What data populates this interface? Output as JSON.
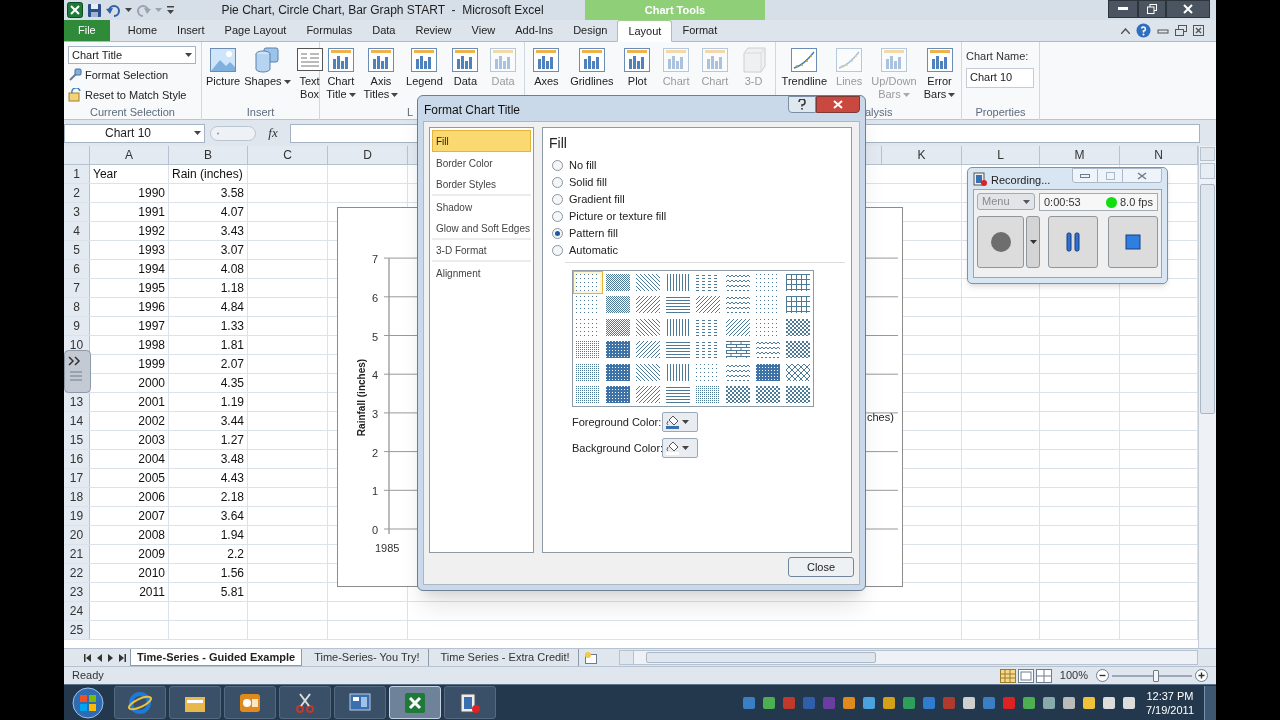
{
  "title_bar": {
    "title": "Pie Chart, Circle Chart, Bar Graph START  -  Microsoft Excel",
    "context_label": "Chart Tools"
  },
  "ribbon_tabs": [
    {
      "label": "File",
      "kind": "file",
      "selected": false
    },
    {
      "label": "Home",
      "kind": "tab",
      "selected": false
    },
    {
      "label": "Insert",
      "kind": "tab",
      "selected": false
    },
    {
      "label": "Page Layout",
      "kind": "tab",
      "selected": false
    },
    {
      "label": "Formulas",
      "kind": "tab",
      "selected": false
    },
    {
      "label": "Data",
      "kind": "tab",
      "selected": false
    },
    {
      "label": "Review",
      "kind": "tab",
      "selected": false
    },
    {
      "label": "View",
      "kind": "tab",
      "selected": false
    },
    {
      "label": "Add-Ins",
      "kind": "tab",
      "selected": false
    },
    {
      "label": "Design",
      "kind": "tab",
      "selected": false
    },
    {
      "label": "Layout",
      "kind": "tab",
      "selected": true
    },
    {
      "label": "Format",
      "kind": "tab",
      "selected": false
    }
  ],
  "ribbon_groups": [
    {
      "kind": "selection",
      "label": "Current Selection",
      "element": "Chart Title",
      "commands": [
        "Format Selection",
        "Reset to Match Style"
      ]
    },
    {
      "kind": "buttons",
      "label": "Insert",
      "buttons": [
        {
          "lines": [
            "Picture"
          ],
          "dropdown": false,
          "disabled": false
        },
        {
          "lines": [
            "Shapes"
          ],
          "dropdown": true,
          "disabled": false
        },
        {
          "lines": [
            "Text",
            "Box"
          ],
          "dropdown": false,
          "disabled": false
        }
      ]
    },
    {
      "kind": "buttons",
      "label": "L",
      "buttons": [
        {
          "lines": [
            "Chart",
            "Title"
          ],
          "dropdown": true,
          "disabled": false
        },
        {
          "lines": [
            "Axis",
            "Titles"
          ],
          "dropdown": true,
          "disabled": false
        },
        {
          "lines": [
            "Legend"
          ],
          "dropdown": false,
          "disabled": false
        },
        {
          "lines": [
            "Data"
          ],
          "dropdown": false,
          "disabled": false
        },
        {
          "lines": [
            "Data"
          ],
          "dropdown": false,
          "disabled": true
        }
      ]
    },
    {
      "kind": "buttons",
      "buttons": [
        {
          "lines": [
            "Axes"
          ],
          "dropdown": false,
          "disabled": false
        },
        {
          "lines": [
            "Gridlines"
          ],
          "dropdown": false,
          "disabled": false
        },
        {
          "lines": [
            "Plot"
          ],
          "dropdown": false,
          "disabled": false
        },
        {
          "lines": [
            "Chart"
          ],
          "dropdown": false,
          "disabled": true
        },
        {
          "lines": [
            "Chart"
          ],
          "dropdown": false,
          "disabled": true
        },
        {
          "lines": [
            "3-D"
          ],
          "dropdown": false,
          "disabled": true
        }
      ]
    },
    {
      "kind": "buttons",
      "label": "alysis",
      "buttons": [
        {
          "lines": [
            "Trendline"
          ],
          "dropdown": false,
          "disabled": false
        },
        {
          "lines": [
            "Lines"
          ],
          "dropdown": false,
          "disabled": true
        },
        {
          "lines": [
            "Up/Down",
            "Bars"
          ],
          "dropdown": true,
          "disabled": true
        },
        {
          "lines": [
            "Error",
            "Bars"
          ],
          "dropdown": true,
          "disabled": false
        }
      ]
    },
    {
      "kind": "properties",
      "label": "Properties",
      "field_label": "Chart Name:",
      "field_value": "Chart 10"
    }
  ],
  "formula_bar": {
    "name_box": "Chart 10",
    "function_label": "fx"
  },
  "sheet": {
    "columns": [
      "A",
      "B",
      "C",
      "D",
      "K",
      "L",
      "M",
      "N"
    ],
    "rows": [
      {
        "number": "1",
        "kind": "header",
        "cells": [
          "Year",
          "Rain (inches)"
        ]
      },
      {
        "number": "2",
        "kind": "data",
        "cells": [
          "1990",
          "3.58"
        ]
      },
      {
        "number": "3",
        "kind": "data",
        "cells": [
          "1991",
          "4.07"
        ]
      },
      {
        "number": "4",
        "kind": "data",
        "cells": [
          "1992",
          "3.43"
        ]
      },
      {
        "number": "5",
        "kind": "data",
        "cells": [
          "1993",
          "3.07"
        ]
      },
      {
        "number": "6",
        "kind": "data",
        "cells": [
          "1994",
          "4.08"
        ]
      },
      {
        "number": "7",
        "kind": "data",
        "cells": [
          "1995",
          "1.18"
        ]
      },
      {
        "number": "8",
        "kind": "data",
        "cells": [
          "1996",
          "4.84"
        ]
      },
      {
        "number": "9",
        "kind": "data",
        "cells": [
          "1997",
          "1.33"
        ]
      },
      {
        "number": "10",
        "kind": "data",
        "cells": [
          "1998",
          "1.81"
        ]
      },
      {
        "kind": "data",
        "cells": [
          "1999",
          "2.07"
        ]
      },
      {
        "kind": "data",
        "cells": [
          "2000",
          "4.35"
        ]
      },
      {
        "number": "13",
        "kind": "data",
        "cells": [
          "2001",
          "1.19"
        ]
      },
      {
        "number": "14",
        "kind": "data",
        "cells": [
          "2002",
          "3.44"
        ]
      },
      {
        "number": "15",
        "kind": "data",
        "cells": [
          "2003",
          "1.27"
        ]
      },
      {
        "number": "16",
        "kind": "data",
        "cells": [
          "2004",
          "3.48"
        ]
      },
      {
        "number": "17",
        "kind": "data",
        "cells": [
          "2005",
          "4.43"
        ]
      },
      {
        "number": "18",
        "kind": "data",
        "cells": [
          "2006",
          "2.18"
        ]
      },
      {
        "number": "19",
        "kind": "data",
        "cells": [
          "2007",
          "3.64"
        ]
      },
      {
        "number": "20",
        "kind": "data",
        "cells": [
          "2008",
          "1.94"
        ]
      },
      {
        "number": "21",
        "kind": "data",
        "cells": [
          "2009",
          "2.2"
        ]
      },
      {
        "number": "22",
        "kind": "data",
        "cells": [
          "2010",
          "1.56"
        ]
      },
      {
        "number": "23",
        "kind": "data",
        "cells": [
          "2011",
          "5.81"
        ]
      },
      {
        "number": "24",
        "kind": "empty"
      },
      {
        "number": "25",
        "kind": "empty"
      }
    ]
  },
  "chart": {
    "ylabel": "Rainfall (inches)",
    "yticks": [
      "7",
      "6",
      "5",
      "4",
      "3",
      "2",
      "1",
      "0"
    ],
    "xtick": "1985",
    "legend_fragment": "ches)"
  },
  "dialog": {
    "title": "Format Chart Title",
    "categories": [
      {
        "label": "Fill",
        "selected": true
      },
      {
        "label": "Border Color",
        "selected": false
      },
      {
        "label": "Border Styles",
        "selected": false
      },
      {
        "label": "Shadow",
        "selected": false
      },
      {
        "label": "Glow and Soft Edges",
        "selected": false
      },
      {
        "label": "3-D Format",
        "selected": false
      },
      {
        "label": "Alignment",
        "selected": false
      }
    ],
    "section_title": "Fill",
    "fill_options": [
      {
        "label": "No fill",
        "selected": false
      },
      {
        "label": "Solid fill",
        "selected": false
      },
      {
        "label": "Gradient fill",
        "selected": false
      },
      {
        "label": "Picture or texture fill",
        "selected": false
      },
      {
        "label": "Pattern fill",
        "selected": true
      },
      {
        "label": "Automatic",
        "selected": false
      }
    ],
    "patterns": [
      {
        "selected": true
      },
      {
        "selected": false
      },
      {
        "selected": false
      },
      {
        "selected": false
      },
      {
        "selected": false
      },
      {
        "selected": false
      },
      {
        "selected": false
      },
      {
        "selected": false
      },
      {
        "selected": false
      },
      {
        "selected": false
      },
      {
        "selected": false
      },
      {
        "selected": false
      },
      {
        "selected": false
      },
      {
        "selected": false
      },
      {
        "selected": false
      },
      {
        "selected": false
      },
      {
        "selected": false
      },
      {
        "selected": false
      },
      {
        "selected": false
      },
      {
        "selected": false
      },
      {
        "selected": false
      },
      {
        "selected": false
      },
      {
        "selected": false
      },
      {
        "selected": false
      },
      {
        "selected": false
      },
      {
        "selected": false
      },
      {
        "selected": false
      },
      {
        "selected": false
      },
      {
        "selected": false
      },
      {
        "selected": false
      },
      {
        "selected": false
      },
      {
        "selected": false
      },
      {
        "selected": false
      },
      {
        "selected": false
      },
      {
        "selected": false
      },
      {
        "selected": false
      },
      {
        "selected": false
      },
      {
        "selected": false
      },
      {
        "selected": false
      },
      {
        "selected": false
      },
      {
        "selected": false
      },
      {
        "selected": false
      },
      {
        "selected": false
      },
      {
        "selected": false
      },
      {
        "selected": false
      },
      {
        "selected": false
      },
      {
        "selected": false
      },
      {
        "selected": false
      }
    ],
    "color_pickers": [
      {
        "label": "Foreground Color:",
        "color": "#3a6fb0"
      },
      {
        "label": "Background Color:",
        "color": "#ffffff"
      }
    ],
    "close_button": "Close"
  },
  "recorder": {
    "title": "Recording...",
    "menu": "Menu",
    "elapsed": "0:00:53",
    "fps": "8.0 fps"
  },
  "sheet_tabs": [
    {
      "label": "Time-Series - Guided Example",
      "selected": true
    },
    {
      "label": "Time-Series- You Try!",
      "selected": false
    },
    {
      "label": "Time Series - Extra Credit!",
      "selected": false
    }
  ],
  "status_bar": {
    "text": "Ready",
    "zoom_label": "100%",
    "zoom_slider": {
      "level": 0.55
    }
  },
  "taskbar": {
    "apps": [
      {
        "selected": false
      },
      {
        "selected": false
      },
      {
        "selected": false
      },
      {
        "selected": false
      },
      {
        "selected": false
      },
      {
        "selected": true
      },
      {
        "selected": false
      }
    ],
    "time": "12:37 PM",
    "date": "7/19/2011"
  }
}
